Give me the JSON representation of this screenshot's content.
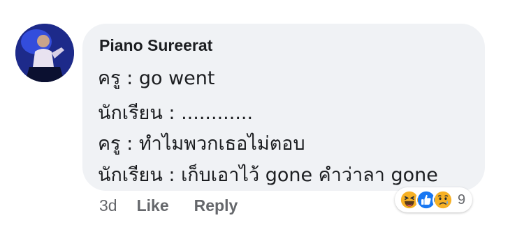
{
  "comment": {
    "author": "Piano Sureerat",
    "lines": [
      "ครู :  go went",
      "นักเรียน : ............",
      "ครู : ทำไมพวกเธอไม่ตอบ",
      "นักเรียน : เก็บเอาไว้ gone คำว่าลา gone"
    ],
    "timestamp": "3d",
    "like_label": "Like",
    "reply_label": "Reply",
    "reaction_count": "9",
    "reactions": [
      "haha-icon",
      "like-icon",
      "sad-icon"
    ]
  },
  "colors": {
    "bubble": "#f0f2f5",
    "text": "#1c1e21",
    "meta": "#65676b",
    "like_blue": "#1877f2",
    "emoji_yellow": "#f7b125"
  }
}
